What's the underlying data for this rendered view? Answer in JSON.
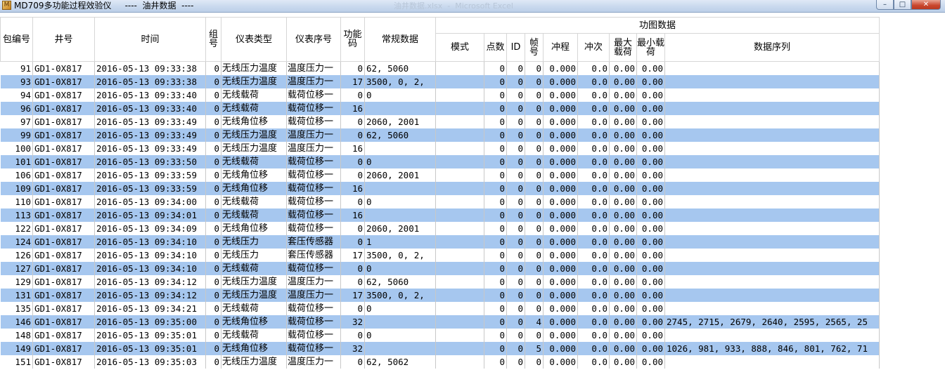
{
  "window": {
    "title": "MD709多功能过程效验仪     ----  油井数据  ----",
    "faded_title": "油井数据.xlsx  -  Microsoft Excel",
    "icon_label": "M",
    "minimize_label": "–",
    "maximize_label": "□",
    "close_label": "✕"
  },
  "grid": {
    "group_header": "功图数据",
    "headers": {
      "packet_no": "包编号",
      "well_no": "井号",
      "time": "时间",
      "group_no": "组号",
      "instrument_type": "仪表类型",
      "instrument_serial": "仪表序号",
      "function_code": "功能码",
      "regular_data": "常规数据",
      "mode": "模式",
      "points": "点数",
      "id": "ID",
      "frame": "帧号",
      "stroke": "冲程",
      "strokes_per_min": "冲次",
      "max_load": "最大载荷",
      "min_load": "最小载荷",
      "data_sequence": "数据序列"
    },
    "rows": [
      {
        "packet": "91",
        "well": "GD1-0X817",
        "time": "2016-05-13 09:33:38",
        "group": "0",
        "type": "无线压力温度",
        "serial": "温度压力一",
        "func": "0",
        "regular": "62, 5060",
        "mode": "",
        "points": "0",
        "id": "0",
        "frame": "0",
        "stroke": "0.000",
        "spm": "0.0",
        "maxload": "0.00",
        "minload": "0.00",
        "seq": ""
      },
      {
        "packet": "93",
        "well": "GD1-0X817",
        "time": "2016-05-13 09:33:38",
        "group": "0",
        "type": "无线压力温度",
        "serial": "温度压力一",
        "func": "17",
        "regular": "3500, 0, 2,",
        "mode": "",
        "points": "0",
        "id": "0",
        "frame": "0",
        "stroke": "0.000",
        "spm": "0.0",
        "maxload": "0.00",
        "minload": "0.00",
        "seq": ""
      },
      {
        "packet": "94",
        "well": "GD1-0X817",
        "time": "2016-05-13 09:33:40",
        "group": "0",
        "type": "无线载荷",
        "serial": "载荷位移一",
        "func": "0",
        "regular": "0",
        "mode": "",
        "points": "0",
        "id": "0",
        "frame": "0",
        "stroke": "0.000",
        "spm": "0.0",
        "maxload": "0.00",
        "minload": "0.00",
        "seq": ""
      },
      {
        "packet": "96",
        "well": "GD1-0X817",
        "time": "2016-05-13 09:33:40",
        "group": "0",
        "type": "无线载荷",
        "serial": "载荷位移一",
        "func": "16",
        "regular": "",
        "mode": "",
        "points": "0",
        "id": "0",
        "frame": "0",
        "stroke": "0.000",
        "spm": "0.0",
        "maxload": "0.00",
        "minload": "0.00",
        "seq": ""
      },
      {
        "packet": "97",
        "well": "GD1-0X817",
        "time": "2016-05-13 09:33:49",
        "group": "0",
        "type": "无线角位移",
        "serial": "载荷位移一",
        "func": "0",
        "regular": "2060, 2001",
        "mode": "",
        "points": "0",
        "id": "0",
        "frame": "0",
        "stroke": "0.000",
        "spm": "0.0",
        "maxload": "0.00",
        "minload": "0.00",
        "seq": ""
      },
      {
        "packet": "99",
        "well": "GD1-0X817",
        "time": "2016-05-13 09:33:49",
        "group": "0",
        "type": "无线压力温度",
        "serial": "温度压力一",
        "func": "0",
        "regular": "62, 5060",
        "mode": "",
        "points": "0",
        "id": "0",
        "frame": "0",
        "stroke": "0.000",
        "spm": "0.0",
        "maxload": "0.00",
        "minload": "0.00",
        "seq": ""
      },
      {
        "packet": "100",
        "well": "GD1-0X817",
        "time": "2016-05-13 09:33:49",
        "group": "0",
        "type": "无线压力温度",
        "serial": "温度压力一",
        "func": "16",
        "regular": "",
        "mode": "",
        "points": "0",
        "id": "0",
        "frame": "0",
        "stroke": "0.000",
        "spm": "0.0",
        "maxload": "0.00",
        "minload": "0.00",
        "seq": ""
      },
      {
        "packet": "101",
        "well": "GD1-0X817",
        "time": "2016-05-13 09:33:50",
        "group": "0",
        "type": "无线载荷",
        "serial": "载荷位移一",
        "func": "0",
        "regular": "0",
        "mode": "",
        "points": "0",
        "id": "0",
        "frame": "0",
        "stroke": "0.000",
        "spm": "0.0",
        "maxload": "0.00",
        "minload": "0.00",
        "seq": ""
      },
      {
        "packet": "106",
        "well": "GD1-0X817",
        "time": "2016-05-13 09:33:59",
        "group": "0",
        "type": "无线角位移",
        "serial": "载荷位移一",
        "func": "0",
        "regular": "2060, 2001",
        "mode": "",
        "points": "0",
        "id": "0",
        "frame": "0",
        "stroke": "0.000",
        "spm": "0.0",
        "maxload": "0.00",
        "minload": "0.00",
        "seq": ""
      },
      {
        "packet": "109",
        "well": "GD1-0X817",
        "time": "2016-05-13 09:33:59",
        "group": "0",
        "type": "无线角位移",
        "serial": "载荷位移一",
        "func": "16",
        "regular": "",
        "mode": "",
        "points": "0",
        "id": "0",
        "frame": "0",
        "stroke": "0.000",
        "spm": "0.0",
        "maxload": "0.00",
        "minload": "0.00",
        "seq": ""
      },
      {
        "packet": "110",
        "well": "GD1-0X817",
        "time": "2016-05-13 09:34:00",
        "group": "0",
        "type": "无线载荷",
        "serial": "载荷位移一",
        "func": "0",
        "regular": "0",
        "mode": "",
        "points": "0",
        "id": "0",
        "frame": "0",
        "stroke": "0.000",
        "spm": "0.0",
        "maxload": "0.00",
        "minload": "0.00",
        "seq": ""
      },
      {
        "packet": "113",
        "well": "GD1-0X817",
        "time": "2016-05-13 09:34:01",
        "group": "0",
        "type": "无线载荷",
        "serial": "载荷位移一",
        "func": "16",
        "regular": "",
        "mode": "",
        "points": "0",
        "id": "0",
        "frame": "0",
        "stroke": "0.000",
        "spm": "0.0",
        "maxload": "0.00",
        "minload": "0.00",
        "seq": ""
      },
      {
        "packet": "122",
        "well": "GD1-0X817",
        "time": "2016-05-13 09:34:09",
        "group": "0",
        "type": "无线角位移",
        "serial": "载荷位移一",
        "func": "0",
        "regular": "2060, 2001",
        "mode": "",
        "points": "0",
        "id": "0",
        "frame": "0",
        "stroke": "0.000",
        "spm": "0.0",
        "maxload": "0.00",
        "minload": "0.00",
        "seq": ""
      },
      {
        "packet": "124",
        "well": "GD1-0X817",
        "time": "2016-05-13 09:34:10",
        "group": "0",
        "type": "无线压力",
        "serial": "套压传感器",
        "func": "0",
        "regular": "1",
        "mode": "",
        "points": "0",
        "id": "0",
        "frame": "0",
        "stroke": "0.000",
        "spm": "0.0",
        "maxload": "0.00",
        "minload": "0.00",
        "seq": ""
      },
      {
        "packet": "126",
        "well": "GD1-0X817",
        "time": "2016-05-13 09:34:10",
        "group": "0",
        "type": "无线压力",
        "serial": "套压传感器",
        "func": "17",
        "regular": "3500, 0, 2,",
        "mode": "",
        "points": "0",
        "id": "0",
        "frame": "0",
        "stroke": "0.000",
        "spm": "0.0",
        "maxload": "0.00",
        "minload": "0.00",
        "seq": ""
      },
      {
        "packet": "127",
        "well": "GD1-0X817",
        "time": "2016-05-13 09:34:10",
        "group": "0",
        "type": "无线载荷",
        "serial": "载荷位移一",
        "func": "0",
        "regular": "0",
        "mode": "",
        "points": "0",
        "id": "0",
        "frame": "0",
        "stroke": "0.000",
        "spm": "0.0",
        "maxload": "0.00",
        "minload": "0.00",
        "seq": ""
      },
      {
        "packet": "129",
        "well": "GD1-0X817",
        "time": "2016-05-13 09:34:12",
        "group": "0",
        "type": "无线压力温度",
        "serial": "温度压力一",
        "func": "0",
        "regular": "62, 5060",
        "mode": "",
        "points": "0",
        "id": "0",
        "frame": "0",
        "stroke": "0.000",
        "spm": "0.0",
        "maxload": "0.00",
        "minload": "0.00",
        "seq": ""
      },
      {
        "packet": "131",
        "well": "GD1-0X817",
        "time": "2016-05-13 09:34:12",
        "group": "0",
        "type": "无线压力温度",
        "serial": "温度压力一",
        "func": "17",
        "regular": "3500, 0, 2,",
        "mode": "",
        "points": "0",
        "id": "0",
        "frame": "0",
        "stroke": "0.000",
        "spm": "0.0",
        "maxload": "0.00",
        "minload": "0.00",
        "seq": ""
      },
      {
        "packet": "135",
        "well": "GD1-0X817",
        "time": "2016-05-13 09:34:21",
        "group": "0",
        "type": "无线载荷",
        "serial": "载荷位移一",
        "func": "0",
        "regular": "0",
        "mode": "",
        "points": "0",
        "id": "0",
        "frame": "0",
        "stroke": "0.000",
        "spm": "0.0",
        "maxload": "0.00",
        "minload": "0.00",
        "seq": ""
      },
      {
        "packet": "146",
        "well": "GD1-0X817",
        "time": "2016-05-13 09:35:00",
        "group": "0",
        "type": "无线角位移",
        "serial": "载荷位移一",
        "func": "32",
        "regular": "",
        "mode": "",
        "points": "0",
        "id": "0",
        "frame": "4",
        "stroke": "0.000",
        "spm": "0.0",
        "maxload": "0.00",
        "minload": "0.00",
        "seq": "2745, 2715, 2679, 2640, 2595, 2565, 25"
      },
      {
        "packet": "148",
        "well": "GD1-0X817",
        "time": "2016-05-13 09:35:01",
        "group": "0",
        "type": "无线载荷",
        "serial": "载荷位移一",
        "func": "0",
        "regular": "0",
        "mode": "",
        "points": "0",
        "id": "0",
        "frame": "0",
        "stroke": "0.000",
        "spm": "0.0",
        "maxload": "0.00",
        "minload": "0.00",
        "seq": ""
      },
      {
        "packet": "149",
        "well": "GD1-0X817",
        "time": "2016-05-13 09:35:01",
        "group": "0",
        "type": "无线角位移",
        "serial": "载荷位移一",
        "func": "32",
        "regular": "",
        "mode": "",
        "points": "0",
        "id": "0",
        "frame": "5",
        "stroke": "0.000",
        "spm": "0.0",
        "maxload": "0.00",
        "minload": "0.00",
        "seq": "1026, 981, 933, 888, 846, 801, 762, 71"
      },
      {
        "packet": "151",
        "well": "GD1-0X817",
        "time": "2016-05-13 09:35:03",
        "group": "0",
        "type": "无线压力温度",
        "serial": "温度压力一",
        "func": "0",
        "regular": "62, 5062",
        "mode": "",
        "points": "0",
        "id": "0",
        "frame": "0",
        "stroke": "0.000",
        "spm": "0.0",
        "maxload": "0.00",
        "minload": "0.00",
        "seq": ""
      }
    ]
  },
  "colors": {
    "row_alt": "#a6c7ef",
    "row_base": "#ffffff",
    "titlebar": "#c9d9ee"
  }
}
